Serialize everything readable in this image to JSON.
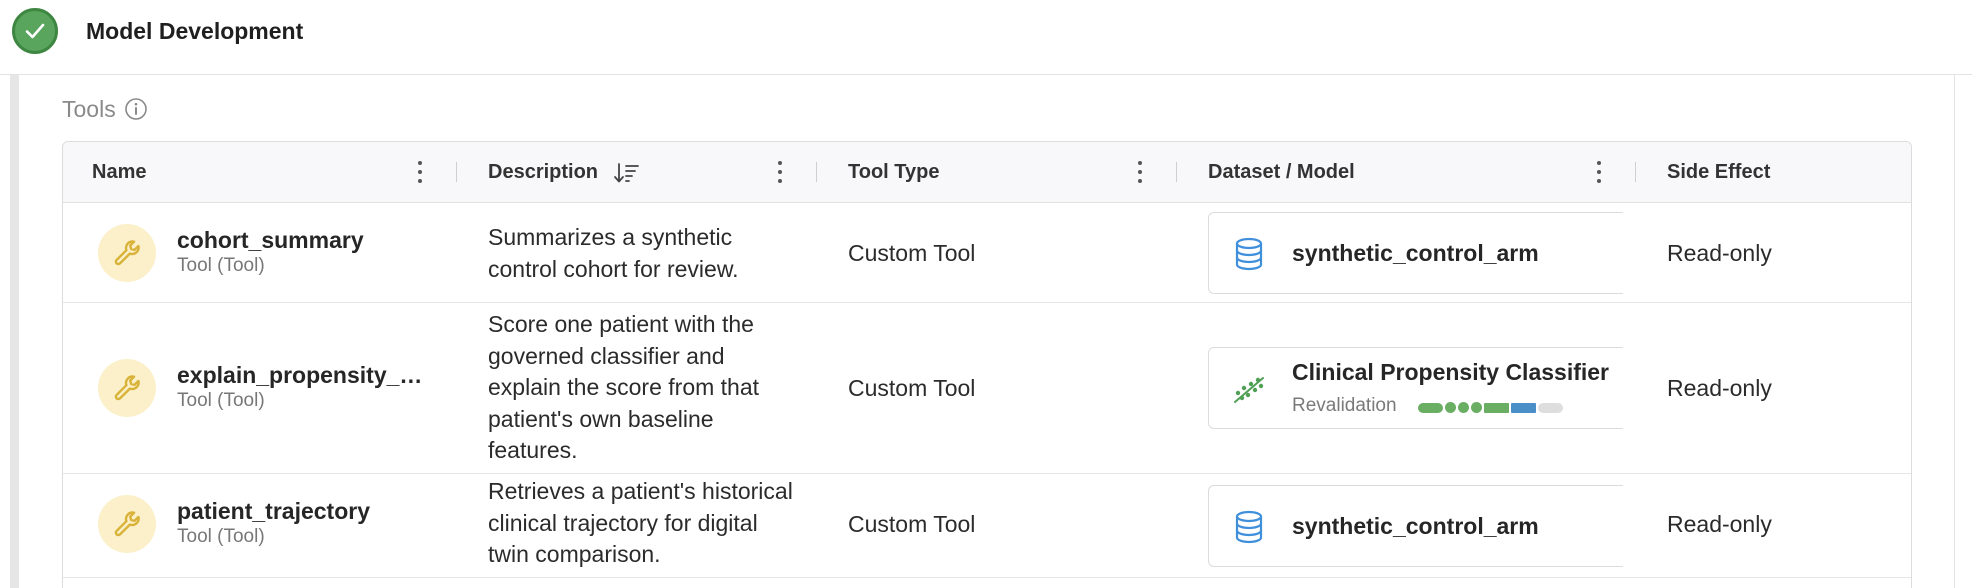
{
  "header": {
    "title": "Model Development",
    "status": "complete"
  },
  "section": {
    "title": "Tools"
  },
  "table": {
    "columns": [
      {
        "label": "Name"
      },
      {
        "label": "Description",
        "sorted": "descending"
      },
      {
        "label": "Tool Type"
      },
      {
        "label": "Dataset / Model"
      },
      {
        "label": "Side Effect"
      }
    ],
    "rows": [
      {
        "name": "cohort_summary",
        "kind": "Tool (Tool)",
        "description": "Summarizes a synthetic control cohort for review.",
        "tool_type": "Custom Tool",
        "resource": {
          "type": "dataset",
          "icon": "database-icon",
          "name": "synthetic_control_arm"
        },
        "side_effect": "Read-only"
      },
      {
        "name": "explain_propensity_score",
        "kind": "Tool (Tool)",
        "description": "Score one patient with the governed classifier and explain the score from that patient's own baseline features.",
        "tool_type": "Custom Tool",
        "resource": {
          "type": "model",
          "icon": "model-scatter-icon",
          "name": "Clinical Propensity Classifier",
          "stage": "Revalidation"
        },
        "side_effect": "Read-only"
      },
      {
        "name": "patient_trajectory",
        "kind": "Tool (Tool)",
        "description": "Retrieves a patient's historical clinical trajectory for digital twin comparison.",
        "tool_type": "Custom Tool",
        "resource": {
          "type": "dataset",
          "icon": "database-icon",
          "name": "synthetic_control_arm"
        },
        "side_effect": "Read-only"
      }
    ]
  },
  "colors": {
    "success_green": "#5aa55e",
    "wrench_gold": "#d9b23a",
    "avatar_bg": "#fbf0c9",
    "dataset_blue": "#3f8fdb",
    "model_green": "#4fa055",
    "pipeline_blue": "#4a8fc7",
    "pipeline_gray": "#dedede"
  }
}
